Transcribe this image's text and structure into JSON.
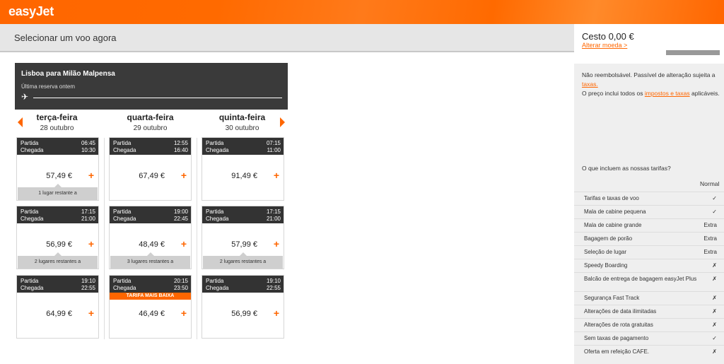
{
  "header": {
    "logo": "easyJet",
    "title": "Selecionar um voo agora"
  },
  "basket": {
    "title": "Cesto 0,00 €",
    "change_currency": "Alterar moeda >"
  },
  "fare_note": {
    "text1": "Não reembolsável. Passível de alteração sujeita a",
    "link1": "taxas.",
    "text2": "O preço inclui todos os",
    "link2": "impostos e taxas",
    "text3": "aplicáveis."
  },
  "includes": {
    "title": "O que incluem as nossas tarifas?",
    "column": "Normal",
    "rows": [
      {
        "label": "Tarifas e taxas de voo",
        "value": "✓"
      },
      {
        "label": "Mala de cabine pequena",
        "value": "✓"
      },
      {
        "label": "Mala de cabine grande",
        "value": "Extra"
      },
      {
        "label": "Bagagem de porão",
        "value": "Extra"
      },
      {
        "label": "Seleção de lugar",
        "value": "Extra"
      },
      {
        "label": "Speedy Boarding",
        "value": "✗"
      },
      {
        "label": "Balcão de entrega de bagagem easyJet Plus",
        "value": "✗"
      },
      {
        "label": "Segurança Fast Track",
        "value": "✗"
      },
      {
        "label": "Alterações de data ilimitadas",
        "value": "✗"
      },
      {
        "label": "Alterações de rota gratuitas",
        "value": "✗"
      },
      {
        "label": "Sem taxas de pagamento",
        "value": "✓"
      },
      {
        "label": "Oferta em refeição CAFE.",
        "value": "✗"
      }
    ]
  },
  "route": {
    "title": "Lisboa para Milão Malpensa",
    "subtitle": "Última reserva ontem"
  },
  "labels": {
    "departure": "Partida",
    "arrival": "Chegada"
  },
  "days": [
    {
      "name": "terça-feira",
      "date": "28 outubro",
      "flights": [
        {
          "dep": "06:45",
          "arr": "10:30",
          "price": "57,49 €",
          "seats": "1 lugar restante a"
        },
        {
          "dep": "17:15",
          "arr": "21:00",
          "price": "56,99 €",
          "seats": "2 lugares restantes a"
        },
        {
          "dep": "19:10",
          "arr": "22:55",
          "price": "64,99 €"
        }
      ]
    },
    {
      "name": "quarta-feira",
      "date": "29 outubro",
      "flights": [
        {
          "dep": "12:55",
          "arr": "16:40",
          "price": "67,49 €"
        },
        {
          "dep": "19:00",
          "arr": "22:45",
          "price": "48,49 €",
          "seats": "3 lugares restantes a"
        },
        {
          "dep": "20:15",
          "arr": "23:50",
          "price": "46,49 €",
          "badge": "TARIFA MAIS BAIXA"
        }
      ]
    },
    {
      "name": "quinta-feira",
      "date": "30 outubro",
      "flights": [
        {
          "dep": "07:15",
          "arr": "11:00",
          "price": "91,49 €"
        },
        {
          "dep": "17:15",
          "arr": "21:00",
          "price": "57,99 €",
          "seats": "2 lugares restantes a"
        },
        {
          "dep": "19:10",
          "arr": "22:55",
          "price": "56,99 €"
        }
      ]
    }
  ],
  "colors": {
    "brand": "#ff6600",
    "dark": "#333333"
  }
}
